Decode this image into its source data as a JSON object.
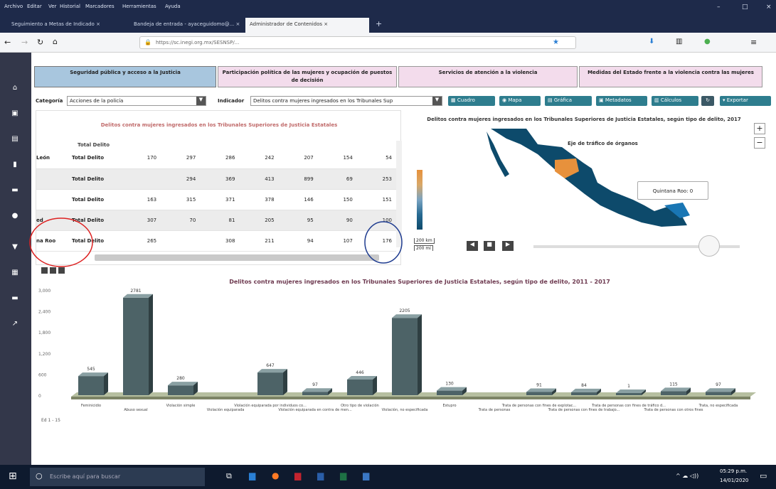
{
  "browser": {
    "menu": [
      "Archivo",
      "Editar",
      "Ver",
      "Historial",
      "Marcadores",
      "Herramientas",
      "Ayuda"
    ],
    "tabs": [
      "Seguimiento a Metas de Indicado",
      "Bandeja de entrada - ayaceguidomo@...",
      "Administrador de Contenidos"
    ],
    "url": "https://sc.inegi.org.mx/SESNSP/..."
  },
  "sidebar_icons": [
    "home-icon",
    "dashboard-icon",
    "calendar-icon",
    "document-icon",
    "briefcase-icon",
    "globe-icon",
    "user-icon",
    "list-icon",
    "mail-icon",
    "chart-icon"
  ],
  "category_tabs": [
    "Seguridad pública y acceso a la Justicia",
    "Participación política de las mujeres y ocupación de puestos de decisión",
    "Servicios de atención a la violencia",
    "Medidas del Estado frente a la violencia contra las mujeres"
  ],
  "filters": {
    "category_label": "Categoría",
    "category_value": "Acciones de la policía",
    "indicator_label": "Indicador",
    "indicator_value": "Delitos contra mujeres ingresados en los Tribunales Sup"
  },
  "toolbar": [
    "Cuadro",
    "Mapa",
    "Gráfica",
    "Metadatos",
    "Cálculos",
    "Exportar"
  ],
  "table": {
    "title": "Delitos contra mujeres ingresados en los Tribunales Superiores de Justicia Estatales",
    "header": "Total Delito",
    "rows": [
      {
        "state": "León",
        "label": "Total Delito",
        "values": [
          "170",
          "297",
          "286",
          "242",
          "207",
          "154",
          "54"
        ]
      },
      {
        "state": "",
        "label": "Total Delito",
        "values": [
          "",
          "294",
          "369",
          "413",
          "899",
          "69",
          "253"
        ]
      },
      {
        "state": "",
        "label": "Total Delito",
        "values": [
          "163",
          "315",
          "371",
          "378",
          "146",
          "150",
          "151"
        ]
      },
      {
        "state": "ed",
        "label": "Total Delito",
        "values": [
          "307",
          "70",
          "81",
          "205",
          "95",
          "90",
          "100"
        ]
      },
      {
        "state": "na Roo",
        "label": "Total Delito",
        "values": [
          "265",
          "",
          "308",
          "211",
          "94",
          "107",
          "176"
        ]
      }
    ]
  },
  "map": {
    "title": "Delitos contra mujeres ingresados en los Tribunales Superiores de Justicia Estatales, según tipo de delito, 2017",
    "subtitle": "Eje de tráfico de órganos",
    "tooltip": "Quintana Roo: 0",
    "scale_1": "200 km",
    "scale_2": "200 mi",
    "colors": {
      "land": "#0d4a6b",
      "highlight": "#e7913c"
    }
  },
  "chart": {
    "title": "Delitos contra mujeres ingresados en los Tribunales Superiores de Justicia Estatales, según tipo de delito, 2011 - 2017",
    "footer": "Ed 1 - 15"
  },
  "chart_data": {
    "type": "bar",
    "title": "Delitos contra mujeres ingresados en los Tribunales Superiores de Justicia Estatales, según tipo de delito, 2011 - 2017",
    "categories": [
      "Feminicidio",
      "Abuso sexual",
      "Violación simple",
      "Violación equiparada",
      "Violación equiparada por individuos co...",
      "Violación equiparada en contra de men...",
      "Otro tipo de violación",
      "Violación, no especificada",
      "Estupro",
      "Trata de personas",
      "Trata de personas con fines de explotac...",
      "Trata de personas con fines de trabajo...",
      "Trata de personas con fines de tráfico d...",
      "Trata de personas con otros fines",
      "Trata, no especificada"
    ],
    "values": [
      545,
      2781,
      280,
      0,
      647,
      97,
      446,
      2205,
      130,
      0,
      91,
      84,
      1,
      115,
      97
    ],
    "labels": [
      "545",
      "2781",
      "280",
      "",
      "647",
      "97",
      "446",
      "2205",
      "130",
      "",
      "91",
      "84",
      "1",
      "115",
      "97"
    ],
    "ylim": [
      0,
      3000
    ],
    "yticks": [
      "3,000",
      "2,400",
      "1,800",
      "1,200",
      "600",
      "0"
    ]
  },
  "taskbar": {
    "search_placeholder": "Escribe aquí para buscar",
    "time": "05:29 p.m.",
    "date": "14/01/2020"
  }
}
